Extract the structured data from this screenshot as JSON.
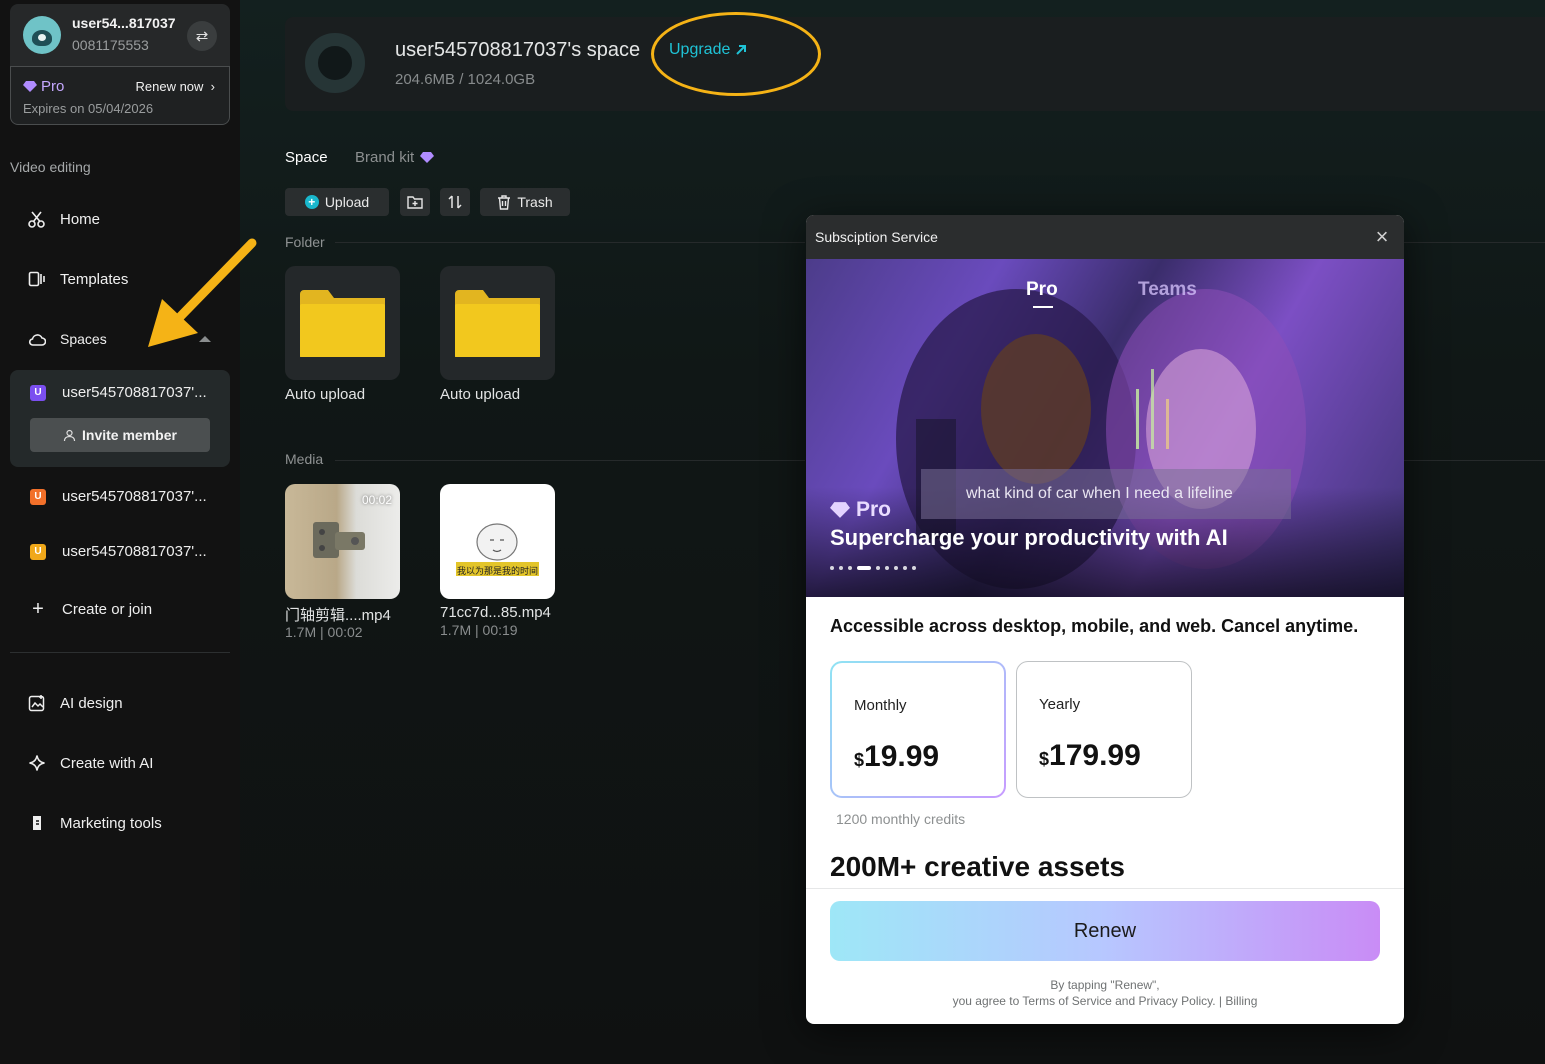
{
  "user": {
    "name": "user54...817037",
    "id": "0081175553",
    "plan": "Pro",
    "renew_label": "Renew now",
    "expires": "Expires on 05/04/2026"
  },
  "sidebar": {
    "section_title": "Video editing",
    "nav": [
      {
        "label": "Home",
        "icon": "scissors-icon"
      },
      {
        "label": "Templates",
        "icon": "templates-icon"
      },
      {
        "label": "Spaces",
        "icon": "cloud-icon"
      }
    ],
    "spaces": [
      {
        "label": "user545708817037'...",
        "badge": "U",
        "color": "#7b4ff0"
      },
      {
        "label": "user545708817037'...",
        "badge": "U",
        "color": "#f2702a"
      },
      {
        "label": "user545708817037'...",
        "badge": "U",
        "color": "#f0a81a"
      }
    ],
    "invite_label": "Invite member",
    "create_join": "Create or join",
    "tools": [
      {
        "label": "AI design",
        "icon": "ai-design-icon"
      },
      {
        "label": "Create with AI",
        "icon": "sparkle-icon"
      },
      {
        "label": "Marketing tools",
        "icon": "marketing-icon"
      }
    ]
  },
  "space": {
    "title": "user545708817037's space",
    "usage": "204.6MB / 1024.0GB",
    "upgrade": "Upgrade"
  },
  "tabs": {
    "space": "Space",
    "brand_kit": "Brand kit"
  },
  "toolbar": {
    "upload": "Upload",
    "trash": "Trash"
  },
  "folders": {
    "label": "Folder",
    "items": [
      {
        "name": "Auto upload"
      },
      {
        "name": "Auto upload"
      }
    ]
  },
  "media": {
    "label": "Media",
    "items": [
      {
        "name": "门轴剪辑....mp4",
        "meta": "1.7M | 00:02",
        "duration": "00:02"
      },
      {
        "name": "71cc7d...85.mp4",
        "meta": "1.7M | 00:19",
        "overlay_text": "我以为那是我的时间"
      }
    ]
  },
  "modal": {
    "title": "Subsciption Service",
    "tabs": {
      "pro": "Pro",
      "teams": "Teams"
    },
    "caption": "what kind of car when I need a lifeline",
    "hero_pro": "Pro",
    "headline": "Supercharge your productivity with AI",
    "access_text": "Accessible across desktop, mobile, and web. Cancel anytime.",
    "plans": [
      {
        "name": "Monthly",
        "currency": "$",
        "price": "19.99"
      },
      {
        "name": "Yearly",
        "currency": "$",
        "price": "179.99"
      }
    ],
    "credits": "1200 monthly credits",
    "assets": "200M+ creative assets",
    "renew": "Renew",
    "terms_line1": "By tapping \"Renew\",",
    "terms_line2": "you agree to Terms of Service and Privacy Policy. | Billing"
  },
  "colors": {
    "accent": "#1fc3d6",
    "highlight": "#f5b316",
    "pro": "#c5a8ff"
  }
}
